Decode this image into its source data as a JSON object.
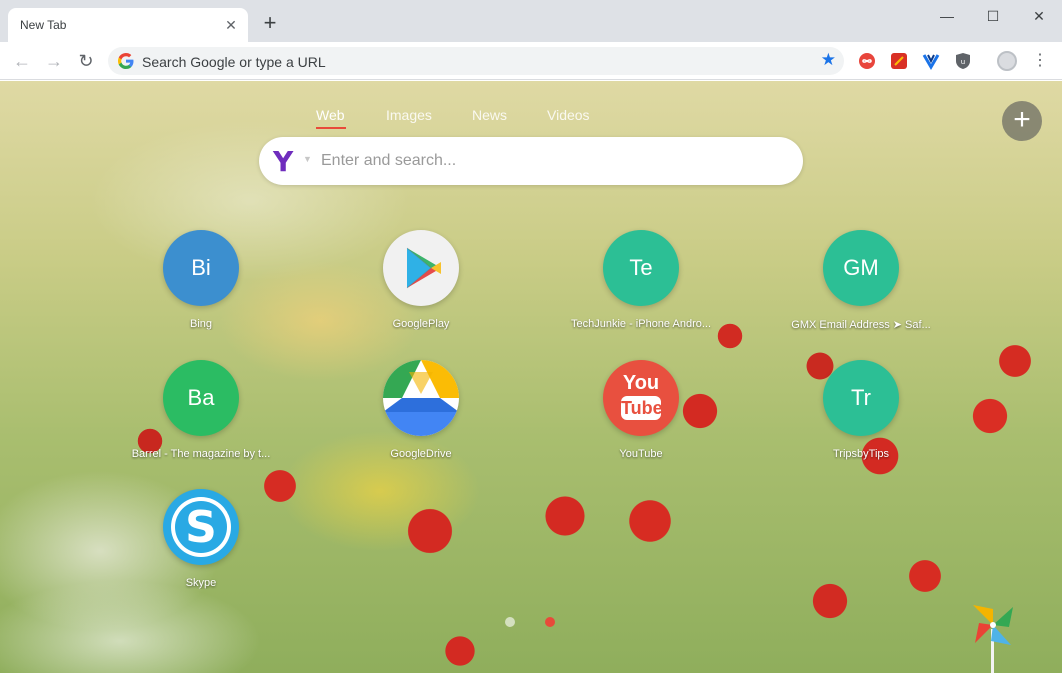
{
  "browser": {
    "tab_title": "New Tab",
    "tab_close": "✕",
    "new_tab": "+",
    "window_min": "—",
    "window_max": "☐",
    "window_close": "✕",
    "back": "←",
    "forward": "→",
    "reload": "↻",
    "omnibox_placeholder": "Search Google or type a URL",
    "star": "★",
    "menu": "⋮"
  },
  "page": {
    "search_tabs": [
      {
        "label": "Web",
        "active": true
      },
      {
        "label": "Images",
        "active": false
      },
      {
        "label": "News",
        "active": false
      },
      {
        "label": "Videos",
        "active": false
      }
    ],
    "engine_logo": "Y",
    "engine_caret": "▼",
    "search_placeholder": "Enter and search...",
    "add_button": "+",
    "tiles": [
      {
        "abbr": "Bi",
        "label": "Bing",
        "color": "#3c8fcf"
      },
      {
        "abbr": "",
        "label": "GooglePlay",
        "color": "#f1f1f1"
      },
      {
        "abbr": "Te",
        "label": "TechJunkie - iPhone Andro...",
        "color": "#2cbf95"
      },
      {
        "abbr": "GM",
        "label": "GMX Email Address ➤ Saf...",
        "color": "#2cbf95"
      },
      {
        "abbr": "Ba",
        "label": "Barrel - The magazine by t...",
        "color": "#2bbc63"
      },
      {
        "abbr": "",
        "label": "GoogleDrive",
        "color": "#ffffff"
      },
      {
        "abbr": "",
        "label": "YouTube",
        "color": "#e8503f"
      },
      {
        "abbr": "Tr",
        "label": "TripsbyTips",
        "color": "#2cbf95"
      },
      {
        "abbr": "",
        "label": "Skype",
        "color": "#29a9e4"
      }
    ],
    "youtube_logo_text": [
      "You",
      "Tube"
    ]
  }
}
